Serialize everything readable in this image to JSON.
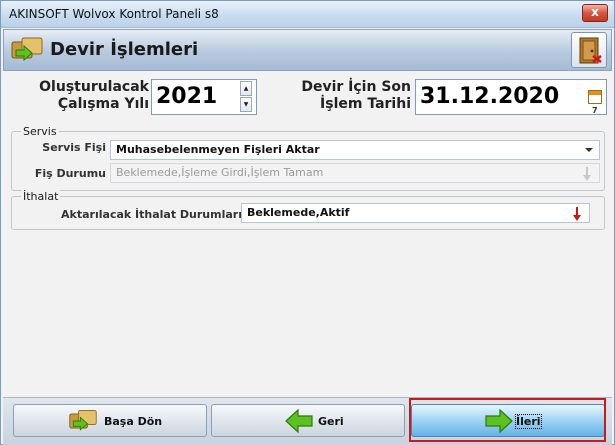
{
  "window": {
    "title": "AKINSOFT Wolvox Kontrol Paneli s8",
    "close_label": "x"
  },
  "header": {
    "title": "Devir İşlemleri"
  },
  "fields": {
    "year_label_line1": "Oluşturulacak",
    "year_label_line2": "Çalışma Yılı",
    "year_value": "2021",
    "date_label_line1": "Devir İçin Son",
    "date_label_line2": "İşlem Tarihi",
    "date_value": "31.12.2020",
    "calendar_day": "7"
  },
  "servis": {
    "group_title": "Servis",
    "fis_label": "Servis Fişi",
    "fis_value": "Muhasebelenmeyen Fişleri Aktar",
    "durum_label": "Fiş Durumu",
    "durum_value": "Beklemede,İşleme Girdi,İşlem Tamam"
  },
  "ithalat": {
    "group_title": "İthalat",
    "durum_label": "Aktarılacak İthalat Durumları",
    "durum_value": "Beklemede,Aktif"
  },
  "buttons": {
    "home": "Başa Dön",
    "back": "Geri",
    "next": "İleri"
  },
  "colors": {
    "highlight": "#cc1a1a",
    "green_arrow": "#5cc21f",
    "red_arrow": "#d01414"
  }
}
